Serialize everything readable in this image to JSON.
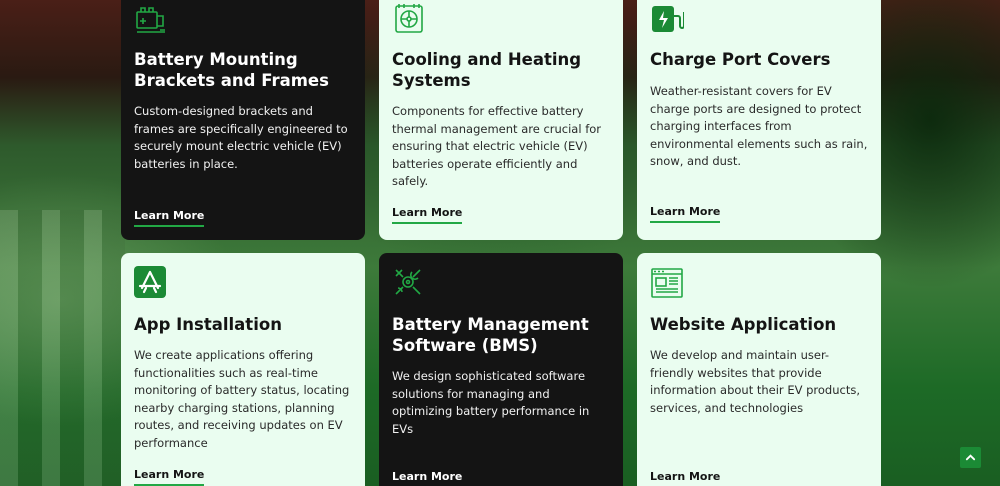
{
  "cards": [
    {
      "title": "Battery Mounting Brackets and Frames",
      "description": "Custom-designed brackets and frames are specifically engineered to securely mount electric vehicle (EV) batteries in place.",
      "link": "Learn More",
      "icon": "battery-bracket-icon"
    },
    {
      "title": "Cooling and Heating Systems",
      "description": "Components for effective battery thermal management are crucial for ensuring that electric vehicle (EV) batteries operate efficiently and safely.",
      "link": "Learn More",
      "icon": "radiator-icon"
    },
    {
      "title": "Charge Port Covers",
      "description": "Weather-resistant covers for EV charge ports are designed to protect charging interfaces from environmental elements such as rain, snow, and dust.",
      "link": "Learn More",
      "icon": "ev-charger-icon"
    },
    {
      "title": "App Installation",
      "description": "We create applications offering functionalities such as real-time monitoring of battery status, locating nearby charging stations, planning routes, and receiving updates on EV performance",
      "link": "Learn More",
      "icon": "app-store-icon"
    },
    {
      "title": "Battery Management Software (BMS)",
      "description": "We design sophisticated software solutions for managing and optimizing battery performance in EVs",
      "link": "Learn More",
      "icon": "wrench-gear-icon"
    },
    {
      "title": "Website Application",
      "description": "We develop and maintain user-friendly websites that provide information about their EV products, services, and technologies",
      "link": "Learn More",
      "icon": "web-app-icon"
    }
  ],
  "colors": {
    "accent": "#22a845",
    "dark_card": "#141414",
    "light_card": "#eafdf0"
  }
}
